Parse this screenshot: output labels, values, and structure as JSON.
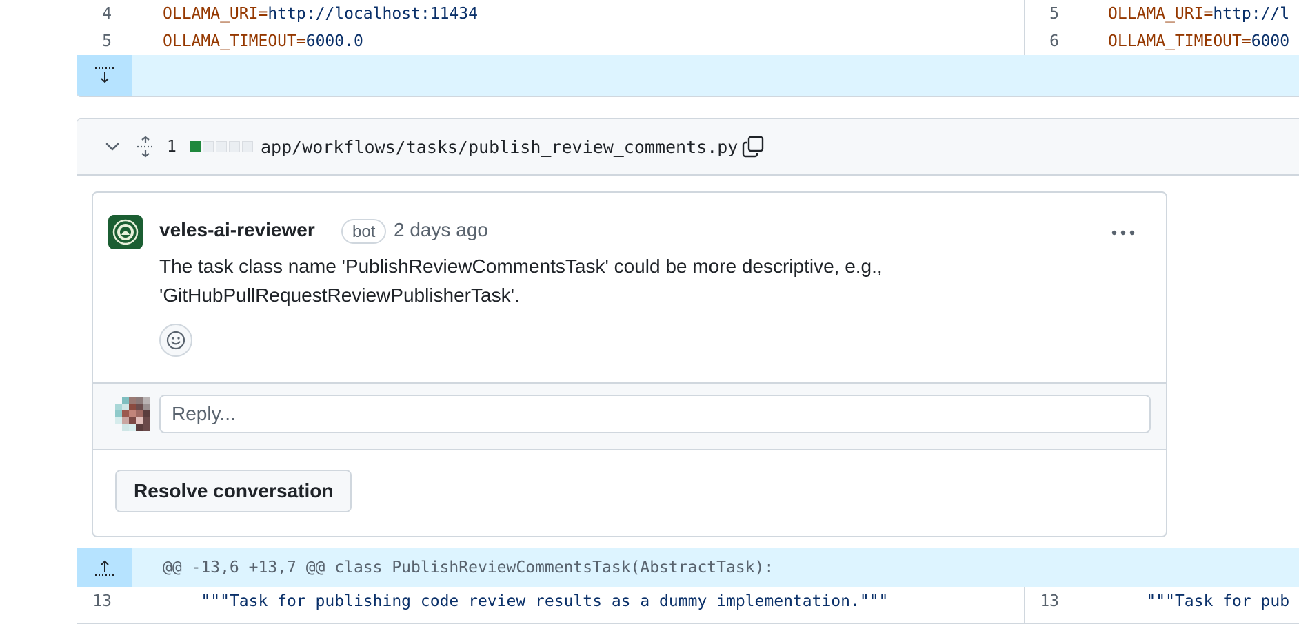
{
  "top_diff": {
    "left_lines": [
      {
        "num": "4",
        "key": "OLLAMA_URI=",
        "value": "http://localhost:11434"
      },
      {
        "num": "5",
        "key": "OLLAMA_TIMEOUT=",
        "value": "6000.0"
      }
    ],
    "right_lines": [
      {
        "num": "5",
        "key": "OLLAMA_URI=",
        "value": "http://l"
      },
      {
        "num": "6",
        "key": "OLLAMA_TIMEOUT=",
        "value": "6000"
      }
    ]
  },
  "file_header": {
    "change_count": "1",
    "diffstat": {
      "added": 1,
      "neutral": 4
    },
    "path": "app/workflows/tasks/publish_review_comments.py"
  },
  "comment": {
    "author": "veles-ai-reviewer",
    "badge": "bot",
    "timestamp": "2 days ago",
    "body_line1": "The task class name 'PublishReviewCommentsTask' could be more descriptive, e.g.,",
    "body_line2": "'GitHubPullRequestReviewPublisherTask'."
  },
  "reply": {
    "placeholder": "Reply..."
  },
  "resolve_label": "Resolve conversation",
  "hunk_header": "@@ -13,6 +13,7 @@ class PublishReviewCommentsTask(AbstractTask):",
  "bottom_lines": {
    "left": {
      "num": "13",
      "text": "    \"\"\"Task for publishing code review results as a dummy implementation.\"\"\""
    },
    "right": {
      "num": "13",
      "text": "    \"\"\"Task for pub"
    }
  },
  "colors": {
    "accent_green": "#1f883d",
    "hunk_bg": "#ddf4ff",
    "hunk_gutter": "#b6e3ff",
    "bot_avatar": "#1b5e32"
  }
}
